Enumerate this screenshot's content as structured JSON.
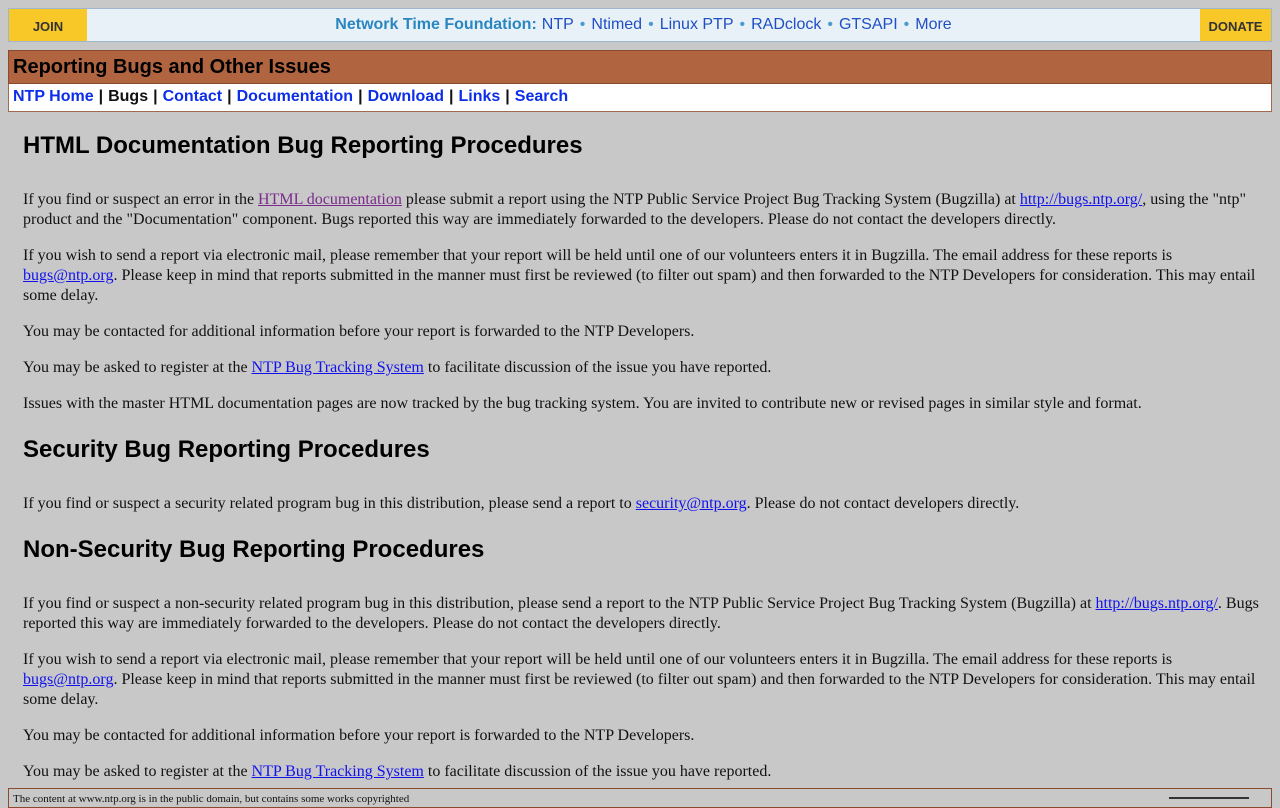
{
  "topbar": {
    "join_label": "JOIN",
    "foundation_label": "Network Time Foundation:",
    "links": [
      "NTP",
      "Ntimed",
      "Linux PTP",
      "RADclock",
      "GTSAPI",
      "More"
    ],
    "bullet": "•",
    "donate_label": "DONATE"
  },
  "header": {
    "title": "Reporting Bugs and Other Issues"
  },
  "nav": {
    "home": "NTP Home",
    "bugs": "Bugs",
    "contact": "Contact",
    "documentation": "Documentation",
    "download": "Download",
    "links": "Links",
    "search": "Search",
    "separator": "|"
  },
  "sections": {
    "html_doc": {
      "heading": "HTML Documentation Bug Reporting Procedures",
      "p1_a": "If you find or suspect an error in the ",
      "p1_link": "HTML documentation",
      "p1_b": " please submit a report using the NTP Public Service Project Bug Tracking System (Bugzilla) at ",
      "p1_url": "http://bugs.ntp.org/",
      "p1_c": ", using the \"ntp\" product and the \"Documentation\" component. Bugs reported this way are immediately forwarded to the developers. Please do not contact the developers directly.",
      "p2_a": "If you wish to send a report via electronic mail, please remember that your report will be held until one of our volunteers enters it in Bugzilla. The email address for these reports is ",
      "p2_email": "bugs@ntp.org",
      "p2_b": ". Please keep in mind that reports submitted in the manner must first be reviewed (to filter out spam) and then forwarded to the NTP Developers for consideration. This may entail some delay.",
      "p3": "You may be contacted for additional information before your report is forwarded to the NTP Developers.",
      "p4_a": "You may be asked to register at the ",
      "p4_link": "NTP Bug Tracking System",
      "p4_b": " to facilitate discussion of the issue you have reported.",
      "p5": "Issues with the master HTML documentation pages are now tracked by the bug tracking system. You are invited to contribute new or revised pages in similar style and format."
    },
    "security": {
      "heading": "Security Bug Reporting Procedures",
      "p1_a": "If you find or suspect a security related program bug in this distribution, please send a report to ",
      "p1_email": "security@ntp.org",
      "p1_b": ". Please do not contact developers directly."
    },
    "non_security": {
      "heading": "Non-Security Bug Reporting Procedures",
      "p1_a": "If you find or suspect a non-security related program bug in this distribution, please send a report to the NTP Public Service Project Bug Tracking System (Bugzilla) at ",
      "p1_url": "http://bugs.ntp.org/",
      "p1_b": ". Bugs reported this way are immediately forwarded to the developers. Please do not contact the developers directly.",
      "p2_a": "If you wish to send a report via electronic mail, please remember that your report will be held until one of our volunteers enters it in Bugzilla. The email address for these reports is ",
      "p2_email": "bugs@ntp.org",
      "p2_b": ". Please keep in mind that reports submitted in the manner must first be reviewed (to filter out spam) and then forwarded to the NTP Developers for consideration. This may entail some delay.",
      "p3": "You may be contacted for additional information before your report is forwarded to the NTP Developers.",
      "p4_a": "You may be asked to register at the ",
      "p4_link": "NTP Bug Tracking System",
      "p4_b": " to facilitate discussion of the issue you have reported."
    }
  },
  "footer": {
    "text": "The content at www.ntp.org is in the public domain, but contains some works copyrighted"
  },
  "colors": {
    "page_bg": "#c8c8c8",
    "title_bar": "#b06440",
    "join_donate": "#f7c828",
    "link": "#1111ee",
    "visited_link": "#7a2a8a"
  }
}
